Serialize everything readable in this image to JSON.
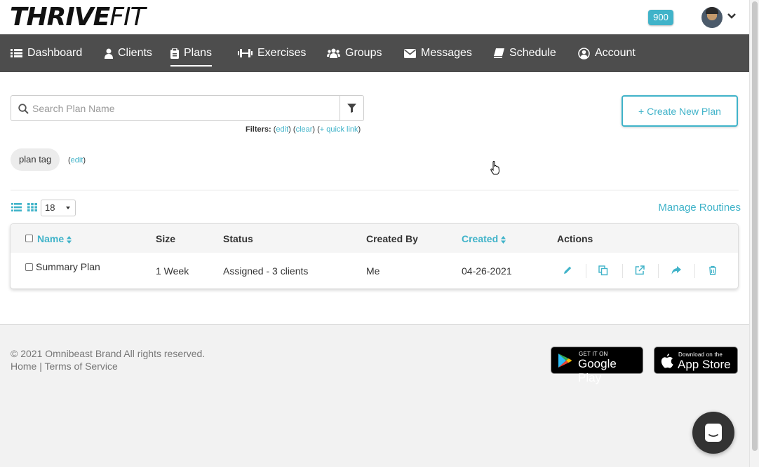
{
  "app": {
    "logo_part1": "THRIVE",
    "logo_part2": "FIT",
    "points_badge": "900"
  },
  "nav": {
    "items": [
      {
        "label": "Dashboard",
        "icon": "list-icon"
      },
      {
        "label": "Clients",
        "icon": "user-icon"
      },
      {
        "label": "Plans",
        "icon": "clipboard-icon",
        "active": true
      },
      {
        "label": "Exercises",
        "icon": "dumbbell-icon"
      },
      {
        "label": "Groups",
        "icon": "users-icon"
      },
      {
        "label": "Messages",
        "icon": "envelope-icon"
      },
      {
        "label": "Schedule",
        "icon": "book-icon"
      },
      {
        "label": "Account",
        "icon": "user-circle-icon"
      }
    ]
  },
  "search": {
    "placeholder": "Search Plan Name",
    "filters_label": "Filters:",
    "filters_edit": "edit",
    "filters_clear": "clear",
    "filters_quick_link": "+ quick link"
  },
  "create_button": "+ Create New Plan",
  "tags": {
    "tag": "plan tag",
    "edit": "edit"
  },
  "list_controls": {
    "per_page": "18",
    "manage_routines": "Manage Routines"
  },
  "table": {
    "columns": [
      "Name",
      "Size",
      "Status",
      "Created By",
      "Created",
      "Actions"
    ],
    "rows": [
      {
        "name": "Summary Plan",
        "size": "1 Week",
        "status": "Assigned - 3 clients",
        "created_by": "Me",
        "created": "04-26-2021"
      }
    ],
    "action_icons": [
      "pencil-icon",
      "copy-icon",
      "external-link-icon",
      "share-icon",
      "trash-icon"
    ]
  },
  "footer": {
    "copyright": "© 2021 Omnibeast Brand All rights reserved.",
    "home": "Home",
    "separator": "|",
    "terms": "Terms of Service",
    "google_small": "GET IT ON",
    "google_big": "Google Play",
    "apple_small": "Download on the",
    "apple_big": "App Store"
  },
  "colors": {
    "accent": "#40b3c9",
    "nav_bg": "#4d4d4d",
    "footer_bg": "#f2f2f2"
  }
}
